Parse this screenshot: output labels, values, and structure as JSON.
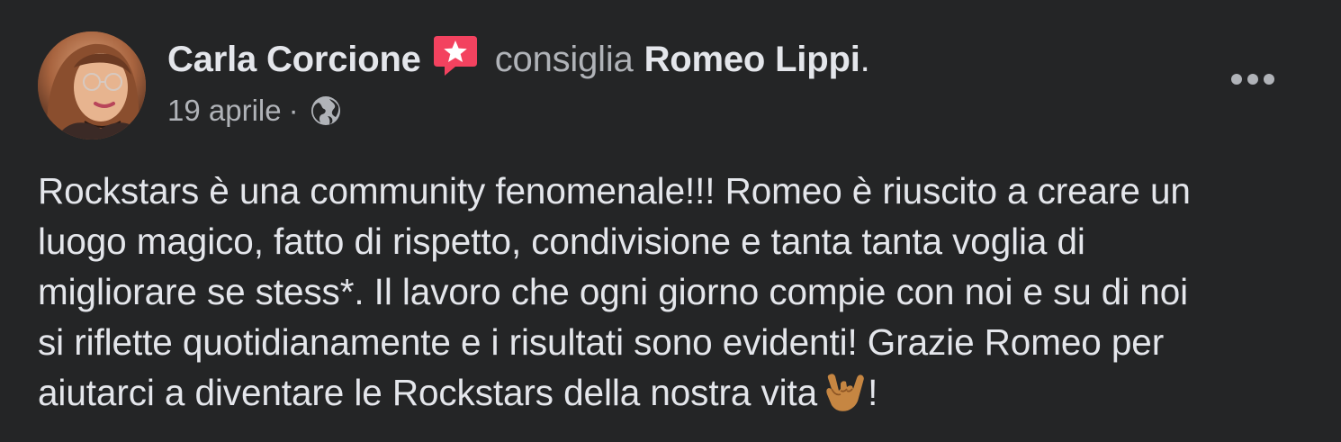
{
  "post": {
    "author": {
      "name": "Carla Corcione",
      "avatar_icon": "profile-photo"
    },
    "recommendation_badge_icon": "star-speech-bubble-icon",
    "action": "consiglia",
    "target": "Romeo Lippi",
    "target_suffix": ".",
    "date": "19 aprile",
    "separator": "·",
    "privacy_icon": "globe-icon",
    "more_icon": "more-options-icon",
    "body_lines": [
      "Rockstars è una community fenomenale!!! Romeo è riuscito a creare un",
      "luogo magico, fatto di rispetto, condivisione e tanta tanta voglia di",
      "migliorare se stess*. Il lavoro che ogni giorno compie con noi e su di noi",
      "si riflette quotidianamente e i risultati sono evidenti! Grazie Romeo per",
      "aiutarci a diventare le Rockstars della nostra vita"
    ],
    "body_end_emoji": "rock-hand-emoji",
    "body_end_punct": "!"
  },
  "colors": {
    "background": "#242526",
    "primary_text": "#e4e6eb",
    "secondary_text": "#b0b3b8",
    "badge": "#f3425f"
  }
}
